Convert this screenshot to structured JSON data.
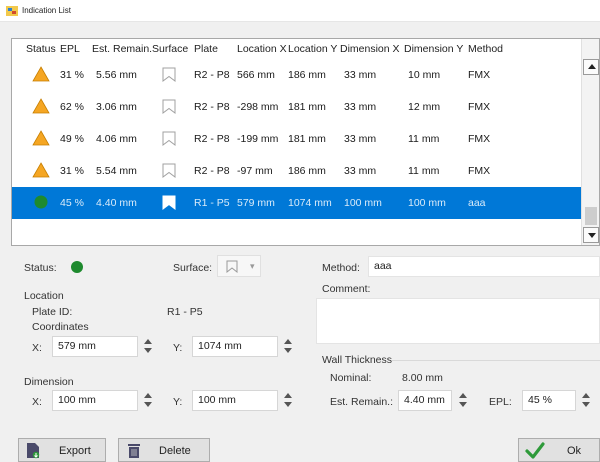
{
  "window": {
    "title": "Indication List"
  },
  "table": {
    "columns": [
      "Status",
      "EPL",
      "Est. Remain.",
      "Surface",
      "Plate",
      "Location X",
      "Location Y",
      "Dimension X",
      "Dimension Y",
      "Method"
    ],
    "rows": [
      {
        "status": "warning",
        "epl": "31 %",
        "est_remain": "5.56 mm",
        "surface": "surface-icon",
        "plate": "R2 - P8",
        "loc_x": "566 mm",
        "loc_y": "186 mm",
        "dim_x": "33 mm",
        "dim_y": "10 mm",
        "method": "FMX"
      },
      {
        "status": "warning",
        "epl": "62 %",
        "est_remain": "3.06 mm",
        "surface": "surface-icon",
        "plate": "R2 - P8",
        "loc_x": "-298 mm",
        "loc_y": "181 mm",
        "dim_x": "33 mm",
        "dim_y": "12 mm",
        "method": "FMX"
      },
      {
        "status": "warning",
        "epl": "49 %",
        "est_remain": "4.06 mm",
        "surface": "surface-icon",
        "plate": "R2 - P8",
        "loc_x": "-199 mm",
        "loc_y": "181 mm",
        "dim_x": "33 mm",
        "dim_y": "11 mm",
        "method": "FMX"
      },
      {
        "status": "warning",
        "epl": "31 %",
        "est_remain": "5.54 mm",
        "surface": "surface-icon",
        "plate": "R2 - P8",
        "loc_x": "-97 mm",
        "loc_y": "186 mm",
        "dim_x": "33 mm",
        "dim_y": "11 mm",
        "method": "FMX"
      },
      {
        "status": "ok",
        "epl": "45 %",
        "est_remain": "4.40 mm",
        "surface": "surface-icon",
        "plate": "R1 - P5",
        "loc_x": "579 mm",
        "loc_y": "1074 mm",
        "dim_x": "100 mm",
        "dim_y": "100 mm",
        "method": "aaa",
        "selected": true
      }
    ]
  },
  "details": {
    "status_label": "Status:",
    "surface_label": "Surface:",
    "method_label": "Method:",
    "method_value": "aaa",
    "comment_label": "Comment:",
    "comment_value": "",
    "location_label": "Location",
    "plate_id_label": "Plate ID:",
    "plate_id_value": "R1 - P5",
    "coordinates_label": "Coordinates",
    "x_label": "X:",
    "loc_x_value": "579 mm",
    "y_label": "Y:",
    "loc_y_value": "1074 mm",
    "dimension_label": "Dimension",
    "dim_x_value": "100 mm",
    "dim_y_value": "100 mm",
    "wall_thickness_label": "Wall Thickness",
    "nominal_label": "Nominal:",
    "nominal_value": "8.00 mm",
    "est_remain_label": "Est. Remain.:",
    "est_remain_value": "4.40 mm",
    "epl_label": "EPL:",
    "epl_value": "45 %"
  },
  "buttons": {
    "export": "Export",
    "delete": "Delete",
    "ok": "Ok"
  },
  "colors": {
    "selection": "#0078d7",
    "warning": "#f5a623",
    "ok_status": "#1e8a2e",
    "ok_check": "#2e9a3a"
  }
}
